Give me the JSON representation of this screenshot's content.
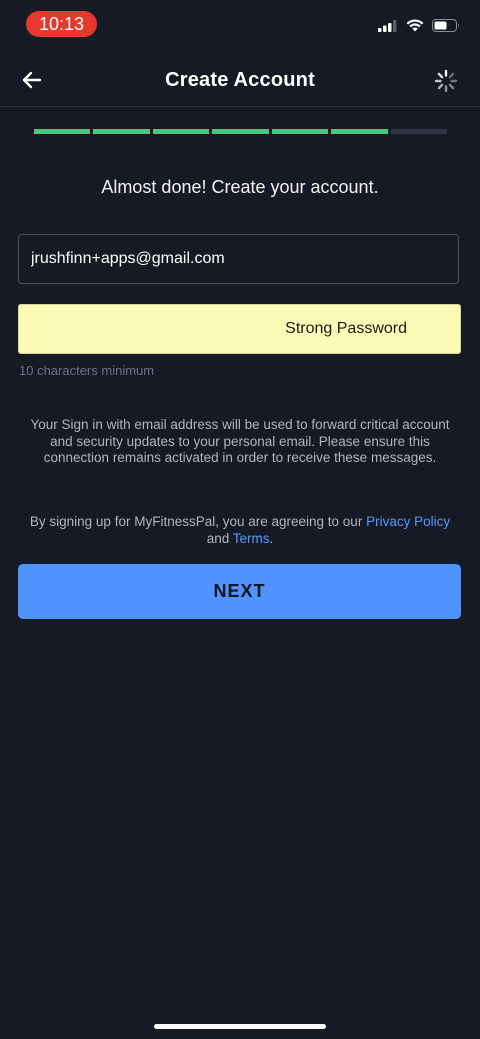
{
  "status_bar": {
    "time": "10:13",
    "signal_icon": "cellular-signal-icon",
    "wifi_icon": "wifi-icon",
    "battery_icon": "battery-icon"
  },
  "nav": {
    "title": "Create Account",
    "back_icon": "back-arrow-icon",
    "loading_icon": "spinner-icon"
  },
  "progress": {
    "completed_steps": 6,
    "total_steps": 7,
    "color_done": "#49c780",
    "color_pending": "#2f3440"
  },
  "form": {
    "heading": "Almost done! Create your account.",
    "email_value": "jrushfinn+apps@gmail.com",
    "password_strength": "Strong Password",
    "password_hint": "10 characters minimum"
  },
  "notice": {
    "text": "Your Sign in with email address will be used to forward critical account and security updates to your personal email. Please ensure this connection remains activated in order to receive these messages."
  },
  "terms": {
    "prefix": "By signing up for MyFitnessPal, you are agreeing to our ",
    "privacy_link": "Privacy Policy",
    "middle": " and ",
    "terms_link": "Terms",
    "suffix": "."
  },
  "actions": {
    "next_label": "NEXT"
  },
  "colors": {
    "background": "#161a24",
    "accent": "#4f93ff",
    "link": "#4f9cff",
    "password_field_bg": "#fbfbb5"
  }
}
